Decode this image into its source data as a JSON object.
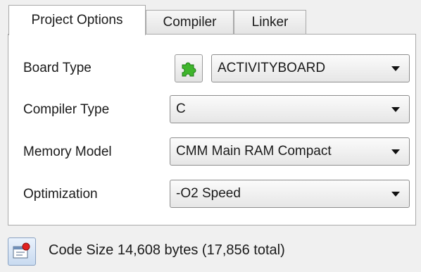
{
  "tabs": [
    {
      "label": "Project Options",
      "active": true
    },
    {
      "label": "Compiler",
      "active": false
    },
    {
      "label": "Linker",
      "active": false
    }
  ],
  "fields": {
    "board_type": {
      "label": "Board Type",
      "value": "ACTIVITYBOARD",
      "icon": "puzzle-piece-icon"
    },
    "compiler_type": {
      "label": "Compiler Type",
      "value": "C"
    },
    "memory_model": {
      "label": "Memory Model",
      "value": "CMM Main RAM Compact"
    },
    "optimization": {
      "label": "Optimization",
      "value": "-O2 Speed"
    }
  },
  "status": {
    "text": "Code Size 14,608 bytes (17,856 total)",
    "icon": "build-status-icon"
  },
  "colors": {
    "puzzle_green": "#3fb52c",
    "status_red": "#e02020"
  }
}
